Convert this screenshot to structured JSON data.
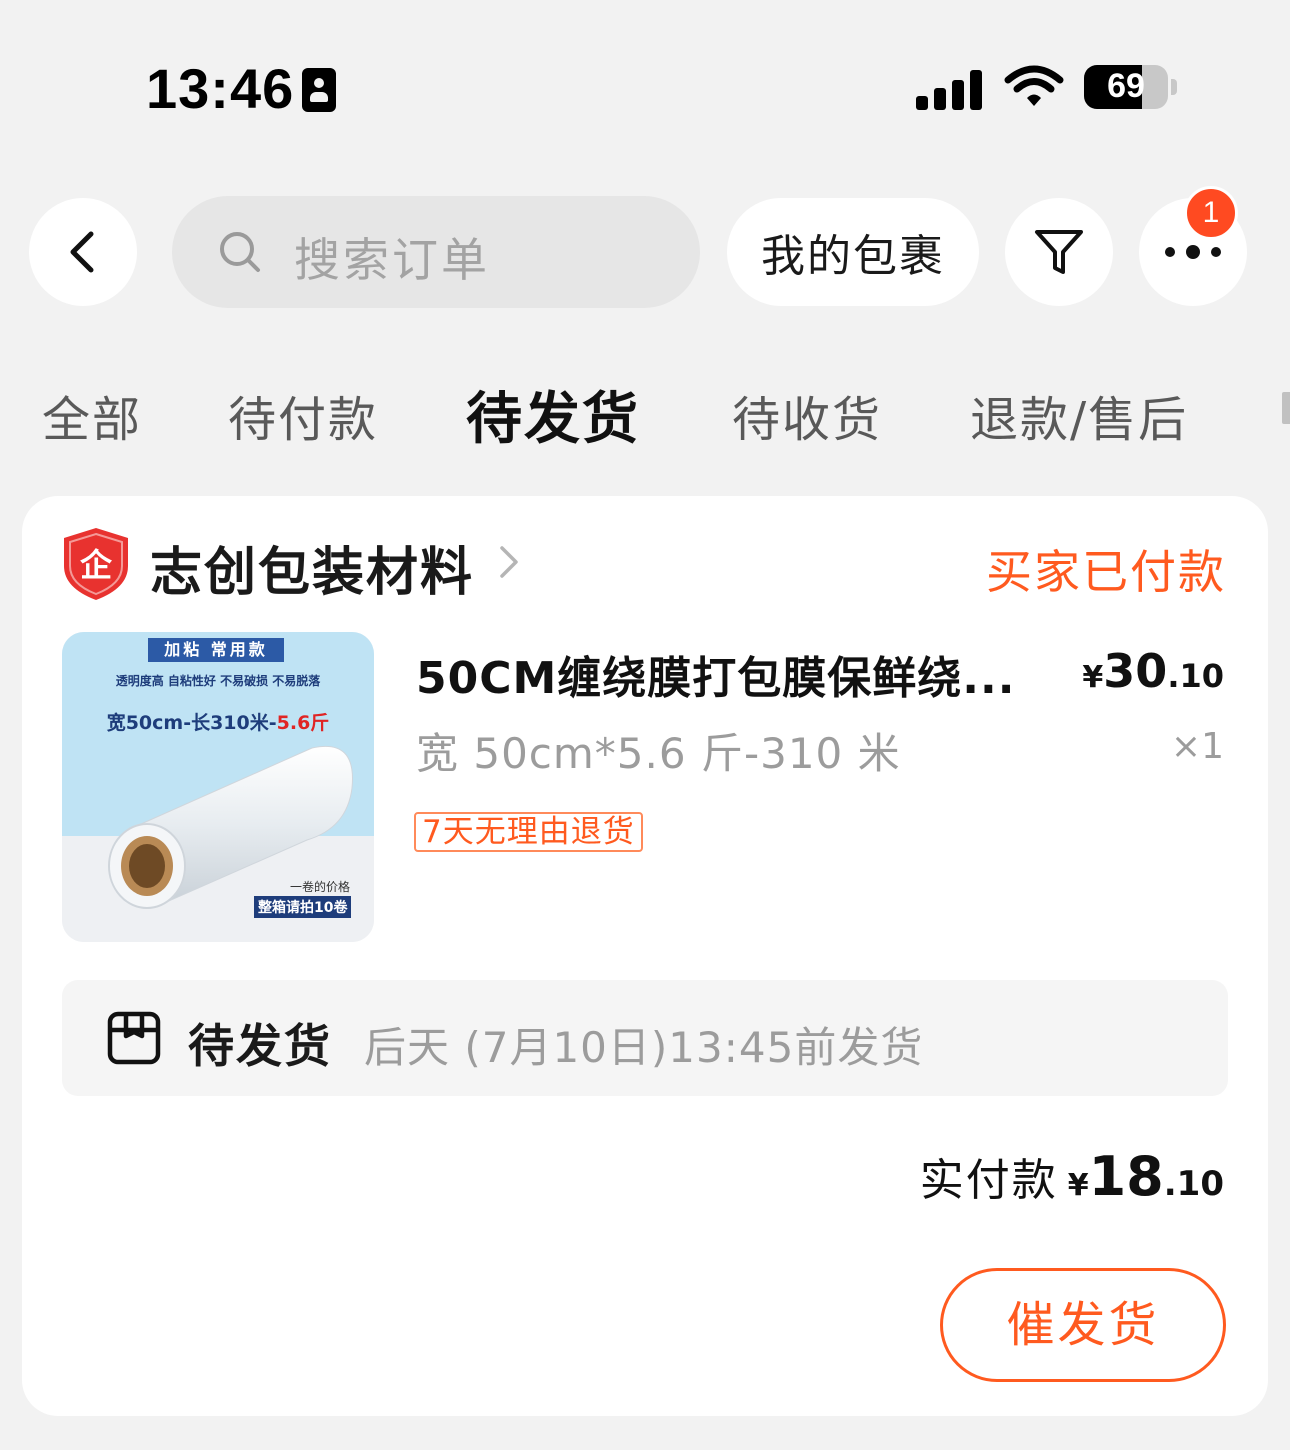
{
  "status_bar": {
    "time": "13:46",
    "battery": "69",
    "battery_level": 0.69,
    "icons": [
      "id-card-icon",
      "cellular-signal-icon",
      "wifi-icon",
      "battery-icon"
    ]
  },
  "top_nav": {
    "back_icon": "chevron-left-icon",
    "search_placeholder": "搜索订单",
    "search_icon": "search-icon",
    "parcel_label": "我的包裹",
    "filter_icon": "funnel-filter-icon",
    "more_icon": "more-dots-icon",
    "more_badge": "1"
  },
  "tabs": [
    {
      "label": "全部",
      "active": false
    },
    {
      "label": "待付款",
      "active": false
    },
    {
      "label": "待发货",
      "active": true
    },
    {
      "label": "待收货",
      "active": false
    },
    {
      "label": "退款/售后",
      "active": false
    }
  ],
  "order": {
    "shop_badge_char": "企",
    "shop_name": "志创包装材料",
    "status": "买家已付款",
    "product": {
      "image": {
        "tag": "加粘 常用款",
        "features": "透明度高 自粘性好 不易破损 不易脱落",
        "spec_text": "宽50cm-长310米-",
        "spec_highlight": "5.6斤",
        "note_1": "一卷的价格",
        "note_2": "整箱请拍10卷"
      },
      "title": "50CM缠绕膜打包膜保鲜绕...",
      "price_symbol": "¥",
      "price_int": "30",
      "price_dec": ".10",
      "spec": "宽 50cm*5.6 斤-310 米",
      "quantity": "×1",
      "return_policy": "7天无理由退货"
    },
    "shipping": {
      "icon": "package-box-icon",
      "label": "待发货",
      "detail": "后天 (7月10日)13:45前发货"
    },
    "paid": {
      "label": "实付款",
      "symbol": "¥",
      "int": "18",
      "dec": ".10"
    },
    "action_button": "催发货"
  },
  "colors": {
    "accent": "#ff5a1f",
    "badge": "#ff4a21",
    "background": "#f2f2f2",
    "card": "#ffffff",
    "muted_text": "#9c9c9c",
    "shop_badge": "#e8322f"
  }
}
